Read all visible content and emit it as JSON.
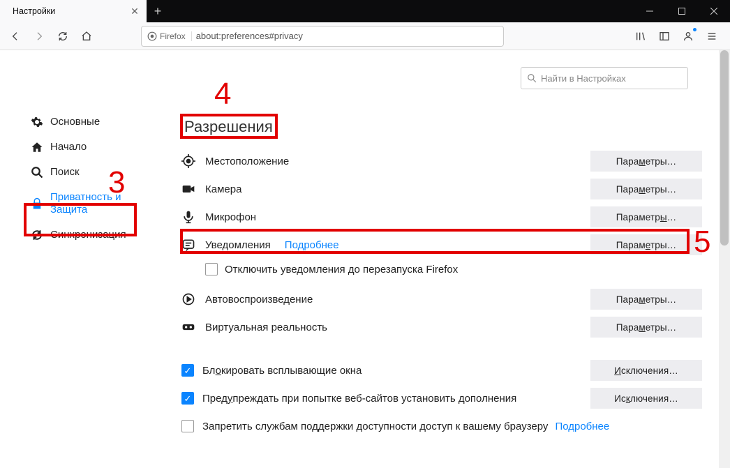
{
  "tab": {
    "title": "Настройки"
  },
  "urlbar": {
    "identity": "Firefox",
    "url": "about:preferences#privacy"
  },
  "search": {
    "placeholder": "Найти в Настройках"
  },
  "sidebar": {
    "items": [
      {
        "label": "Основные"
      },
      {
        "label": "Начало"
      },
      {
        "label": "Поиск"
      },
      {
        "label": "Приватность и\nЗащита"
      },
      {
        "label": "Синхронизация"
      }
    ]
  },
  "section": {
    "title": "Разрешения"
  },
  "perms": {
    "location": {
      "label": "Местоположение",
      "btn_pre": "Пара",
      "btn_u": "м",
      "btn_post": "етры…"
    },
    "camera": {
      "label": "Камера",
      "btn_pre": "Пара",
      "btn_u": "м",
      "btn_post": "етры…"
    },
    "mic": {
      "label": "Микрофон",
      "btn_pre": "Параметр",
      "btn_u": "ы",
      "btn_post": "…"
    },
    "notif": {
      "label": "Уведомления",
      "more": "Подробнее",
      "btn_pre": "Парам",
      "btn_u": "е",
      "btn_post": "тры…"
    },
    "notif_sub": {
      "label": "Отключить уведомления до перезапуска Firefox"
    },
    "autoplay": {
      "label": "Автовоспроизведение",
      "btn_pre": "Пара",
      "btn_u": "м",
      "btn_post": "етры…"
    },
    "vr": {
      "label": "Виртуальная реальность",
      "btn_pre": "Пара",
      "btn_u": "м",
      "btn_post": "етры…"
    }
  },
  "checks": {
    "popup": {
      "pre": "Бл",
      "u": "о",
      "post": "кировать всплывающие окна",
      "btn_pre": "",
      "btn_u": "И",
      "btn_post": "сключения…"
    },
    "addon": {
      "pre": "Пред",
      "u": "у",
      "post": "преждать при попытке веб-сайтов установить дополнения",
      "btn_pre": "Ис",
      "btn_u": "к",
      "btn_post": "лючения…"
    },
    "a11y": {
      "label": "Запретить службам поддержки доступности доступ к вашему браузеру",
      "more": "Подробнее"
    }
  },
  "anno": {
    "n3": "3",
    "n4": "4",
    "n5": "5"
  }
}
